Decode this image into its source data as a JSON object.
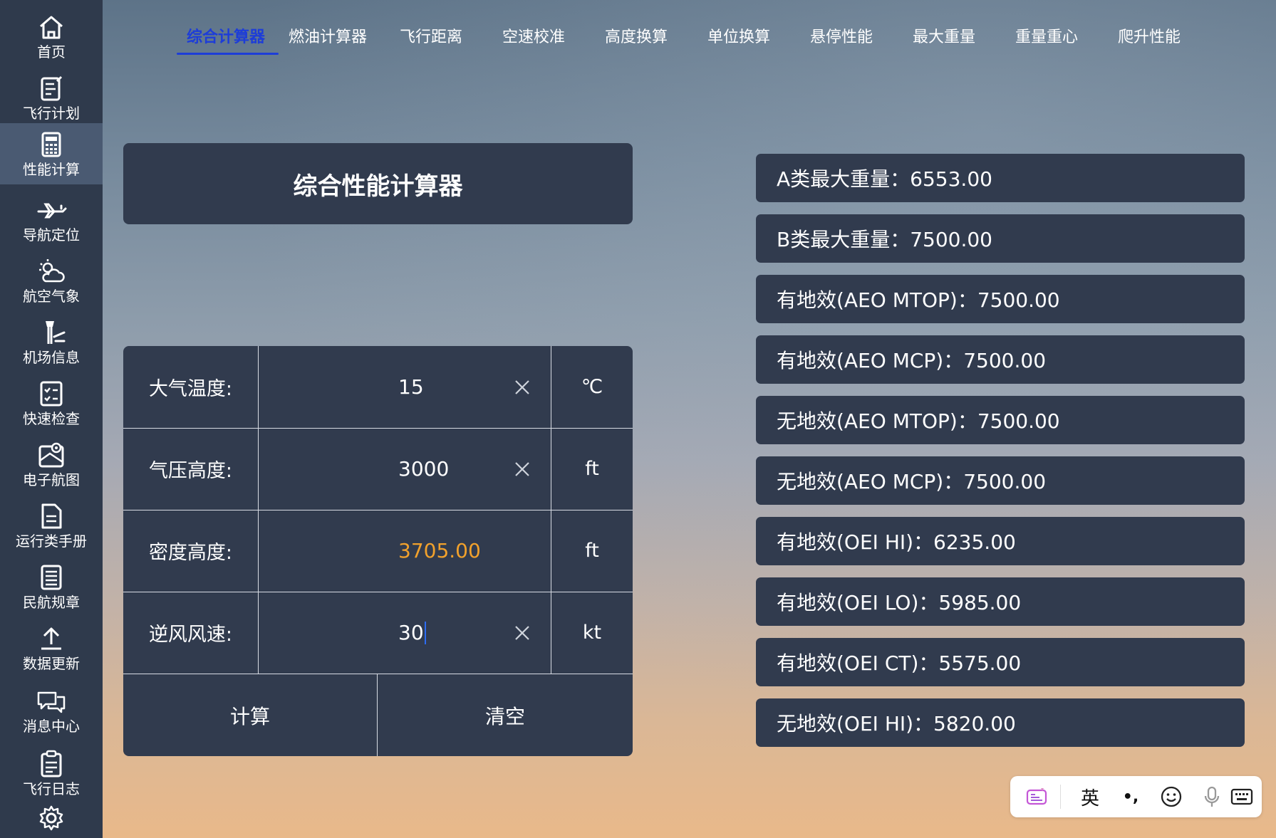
{
  "sidebar": {
    "items": [
      {
        "label": "首页",
        "icon": "home-icon"
      },
      {
        "label": "飞行计划",
        "icon": "flight-plan-icon"
      },
      {
        "label": "性能计算",
        "icon": "calculator-icon",
        "active": true
      },
      {
        "label": "导航定位",
        "icon": "airplane-icon"
      },
      {
        "label": "航空气象",
        "icon": "weather-icon"
      },
      {
        "label": "机场信息",
        "icon": "airport-tower-icon"
      },
      {
        "label": "快速检查",
        "icon": "checklist-icon"
      },
      {
        "label": "电子航图",
        "icon": "map-pin-icon"
      },
      {
        "label": "运行类手册",
        "icon": "document-icon"
      },
      {
        "label": "民航规章",
        "icon": "regulations-list-icon"
      },
      {
        "label": "数据更新",
        "icon": "upload-icon"
      },
      {
        "label": "消息中心",
        "icon": "message-icon"
      },
      {
        "label": "飞行日志",
        "icon": "clipboard-icon"
      }
    ],
    "settings_icon": "gear-icon"
  },
  "tabs": [
    {
      "label": "综合计算器",
      "active": true
    },
    {
      "label": "燃油计算器"
    },
    {
      "label": "飞行距离"
    },
    {
      "label": "空速校准"
    },
    {
      "label": "高度换算"
    },
    {
      "label": "单位换算"
    },
    {
      "label": "悬停性能"
    },
    {
      "label": "最大重量"
    },
    {
      "label": "重量重心"
    },
    {
      "label": "爬升性能"
    }
  ],
  "calculator": {
    "title": "综合性能计算器",
    "fields": [
      {
        "label": "大气温度:",
        "value": "15",
        "unit": "℃",
        "clearable": true
      },
      {
        "label": "气压高度:",
        "value": "3000",
        "unit": "ft",
        "clearable": true
      },
      {
        "label": "密度高度:",
        "value": "3705.00",
        "unit": "ft",
        "clearable": false,
        "computed": true
      },
      {
        "label": "逆风风速:",
        "value": "30",
        "unit": "kt",
        "clearable": true,
        "focused": true
      }
    ],
    "calc_button": "计算",
    "clear_button": "清空"
  },
  "results": [
    "A类最大重量：6553.00",
    "B类最大重量：7500.00",
    "有地效(AEO MTOP)：7500.00",
    "有地效(AEO MCP)：7500.00",
    "无地效(AEO MTOP)：7500.00",
    "无地效(AEO MCP)：7500.00",
    "有地效(OEI HI)：6235.00",
    "有地效(OEI LO)：5985.00",
    "有地效(OEI CT)：5575.00",
    "无地效(OEI HI)：5820.00"
  ],
  "ime": {
    "lang_label": "英",
    "punct_label": "•,",
    "icons": [
      "ime-logo-icon",
      "punctuation-icon",
      "emoji-icon",
      "microphone-icon",
      "keyboard-icon"
    ]
  },
  "colors": {
    "sidebar_bg": "#2f3a4c",
    "card_bg": "#313b4e",
    "active_tab": "#1d3dd8",
    "computed_value": "#f1a12c",
    "caret": "#2d6cf2"
  }
}
